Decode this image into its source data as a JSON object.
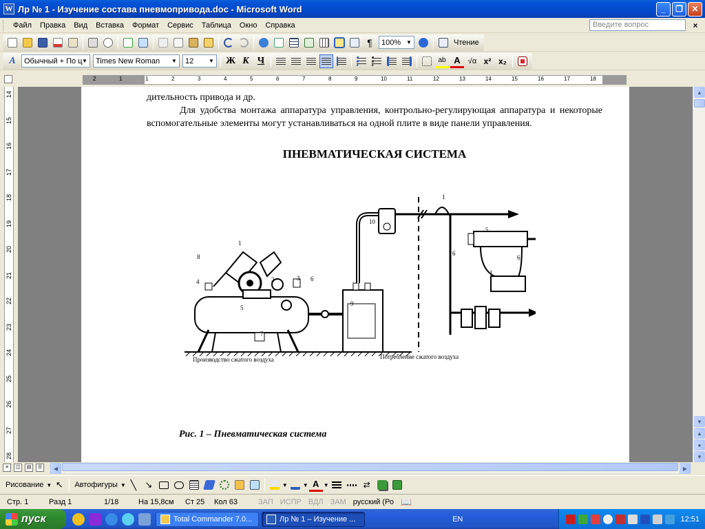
{
  "window": {
    "title": "Лр № 1 - Изучение состава пневмопривода.doc - Microsoft Word",
    "app_icon_letter": "W",
    "minimize": "_",
    "maximize": "❐",
    "close": "✕"
  },
  "menu": {
    "items": [
      "Файл",
      "Правка",
      "Вид",
      "Вставка",
      "Формат",
      "Сервис",
      "Таблица",
      "Окно",
      "Справка"
    ],
    "ask_placeholder": "Введите вопрос",
    "close_doc": "×"
  },
  "standard_toolbar": {
    "zoom": "100%",
    "read_label": "Чтение",
    "paragraph_mark": "¶"
  },
  "format_toolbar": {
    "style": "Обычный + По ц",
    "font": "Times New Roman",
    "size": "12",
    "bold": "Ж",
    "italic": "К",
    "underline": "Ч",
    "superscript": "x²",
    "subscript": "x₂",
    "font_color_letter": "A",
    "highlight_glyph": "ab",
    "sqrt_glyph": "√α",
    "style_glyph": "A"
  },
  "ruler": {
    "h_numbers": [
      "2",
      "1",
      "1",
      "2",
      "3",
      "4",
      "5",
      "6",
      "7",
      "8",
      "9",
      "10",
      "11",
      "12",
      "13",
      "14",
      "15",
      "16",
      "17",
      "18"
    ],
    "v_numbers": [
      "14",
      "15",
      "16",
      "17",
      "18",
      "19",
      "20",
      "21",
      "22",
      "23",
      "24",
      "25",
      "26",
      "27",
      "28"
    ]
  },
  "document": {
    "line_top": "дительность привода и др.",
    "paragraph": "Для удобства монтажа аппаратура управления, контрольно-регулирующая аппаратура и некоторые вспомогательные элементы могут устанавливаться на одной плите в виде панели управления.",
    "heading": "ПНЕВМАТИЧЕСКАЯ СИСТЕМА",
    "figure_left_label": "Производство сжатого воздуха",
    "figure_right_label": "Потребление сжатого воздуха",
    "figure_numbers": [
      "1",
      "2",
      "3",
      "4",
      "5",
      "6",
      "7",
      "8",
      "9",
      "10"
    ],
    "figure_numbers_right": [
      "1",
      "5",
      "6",
      "6",
      "1"
    ],
    "caption": "Рис. 1 – Пневматическая система"
  },
  "drawing_toolbar": {
    "draw": "Рисование",
    "autoshapes": "Автофигуры"
  },
  "status": {
    "page": "Стр. 1",
    "section": "Разд 1",
    "pages": "1/18",
    "at": "На 15,8см",
    "line": "Ст 25",
    "col": "Кол 63",
    "rec": "ЗАП",
    "trk": "ИСПР",
    "ext": "ВДЛ",
    "ovr": "ЗАМ",
    "language": "русский (Ро"
  },
  "taskbar": {
    "start": "пуск",
    "tasks": [
      "Total Commander 7.0...",
      "Лр № 1 – Изучение ..."
    ],
    "lang": "EN",
    "time": "12:51"
  },
  "colors": {
    "titlebar": "#0351d6",
    "taskbar": "#245edb",
    "start": "#2e8b2e",
    "workspace": "#808080"
  }
}
